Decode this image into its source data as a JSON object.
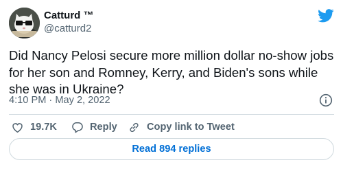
{
  "author": {
    "display_name": "Catturd ™",
    "handle": "@catturd2"
  },
  "tweet": {
    "text": "Did Nancy Pelosi secure more million dollar no-show jobs for her son and Romney, Kerry, and Biden's sons while she was in Ukraine?",
    "timestamp": "4:10 PM · May 2, 2022"
  },
  "actions": {
    "likes": "19.7K",
    "reply": "Reply",
    "copy_link": "Copy link to Tweet"
  },
  "footer": {
    "read_replies": "Read 894 replies"
  },
  "icons": {
    "brand": "twitter-bird-icon",
    "info": "info-icon",
    "like": "heart-icon",
    "reply": "speech-bubble-icon",
    "link": "link-chain-icon"
  },
  "colors": {
    "brand_blue": "#1d9bf0",
    "link_blue": "#006fd6",
    "text": "#0f1419",
    "muted": "#536471",
    "border": "#cfd9de"
  }
}
